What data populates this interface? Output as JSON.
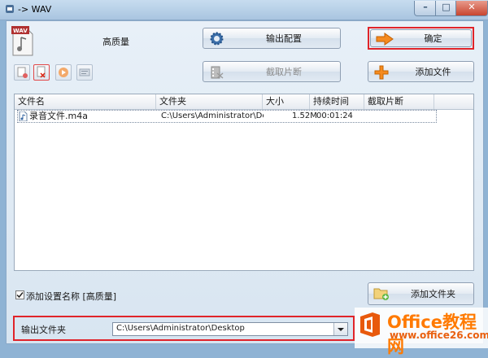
{
  "window": {
    "title": "-> WAV"
  },
  "header": {
    "quality_label": "高质量"
  },
  "buttons": {
    "output_config": "输出配置",
    "ok": "确定",
    "clip": "截取片断",
    "add_file": "添加文件",
    "add_folder": "添加文件夹"
  },
  "table": {
    "columns": [
      "文件名",
      "文件夹",
      "大小",
      "持续时间",
      "截取片断"
    ],
    "rows": [
      {
        "name": "录音文件.m4a",
        "folder": "C:\\Users\\Administrator\\Des...",
        "size": "1.52M",
        "duration": "00:01:24",
        "clip": ""
      }
    ]
  },
  "options": {
    "add_setting_name_label": "添加设置名称 [高质量]",
    "add_setting_name_checked": true
  },
  "output": {
    "folder_label": "输出文件夹",
    "folder_value": "C:\\Users\\Administrator\\Desktop"
  },
  "watermark": {
    "brand": "Office教程网",
    "url": "www.office26.com"
  },
  "colors": {
    "highlight": "#e0242a",
    "accent": "#ff7a00"
  }
}
